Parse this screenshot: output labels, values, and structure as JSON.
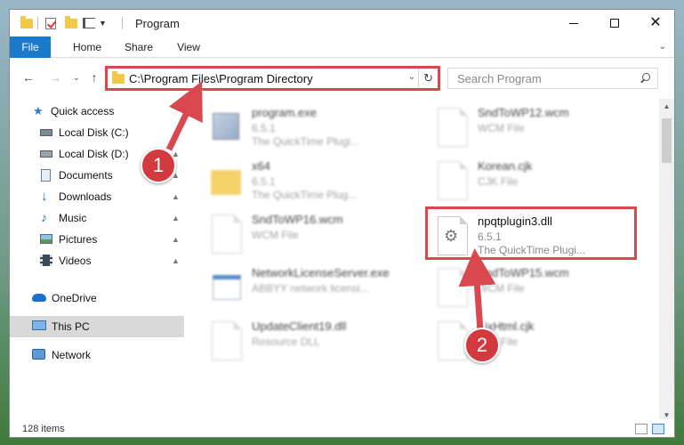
{
  "window": {
    "title": "Program"
  },
  "ribbon": {
    "tabs": [
      "File",
      "Home",
      "Share",
      "View"
    ]
  },
  "address_bar": {
    "path": "C:\\Program Files\\Program Directory"
  },
  "search": {
    "placeholder": "Search Program"
  },
  "sidebar": {
    "items": [
      {
        "label": "Quick access",
        "icon": "star-icon"
      },
      {
        "label": "Local Disk (C:)",
        "icon": "drive-icon"
      },
      {
        "label": "Local Disk (D:)",
        "icon": "drive-icon"
      },
      {
        "label": "Documents",
        "icon": "documents-icon"
      },
      {
        "label": "Downloads",
        "icon": "download-icon"
      },
      {
        "label": "Music",
        "icon": "music-icon"
      },
      {
        "label": "Pictures",
        "icon": "pictures-icon"
      },
      {
        "label": "Videos",
        "icon": "video-icon"
      },
      {
        "label": "OneDrive",
        "icon": "cloud-icon"
      },
      {
        "label": "This PC",
        "icon": "computer-icon"
      },
      {
        "label": "Network",
        "icon": "network-icon"
      }
    ]
  },
  "files": [
    {
      "name": "program.exe",
      "line2": "6.5.1",
      "line3": "The QuickTime Plugi..."
    },
    {
      "name": "SndToWP12.wcm",
      "line2": "WCM File",
      "line3": ""
    },
    {
      "name": "x64",
      "line2": "6.5.1",
      "line3": "The QuickTime Plug..."
    },
    {
      "name": "Korean.cjk",
      "line2": "CJK File",
      "line3": ""
    },
    {
      "name": "SndToWP16.wcm",
      "line2": "WCM File",
      "line3": ""
    },
    {
      "name": "npqtplugin3.dll",
      "line2": "6.5.1",
      "line3": "The QuickTime Plugi..."
    },
    {
      "name": "NetworkLicenseServer.exe",
      "line2": "ABBYY network licensi...",
      "line3": ""
    },
    {
      "name": "SndToWP15.wcm",
      "line2": "WCM File",
      "line3": ""
    },
    {
      "name": "UpdateClient19.dll",
      "line2": "Resource DLL",
      "line3": ""
    },
    {
      "name": "FixHtml.cjk",
      "line2": "CJK File",
      "line3": ""
    }
  ],
  "status": {
    "item_count": "128 items"
  },
  "callouts": [
    "1",
    "2"
  ],
  "colors": {
    "accent": "#1979ca",
    "highlight": "#d9484e",
    "callout": "#d23a3f"
  }
}
